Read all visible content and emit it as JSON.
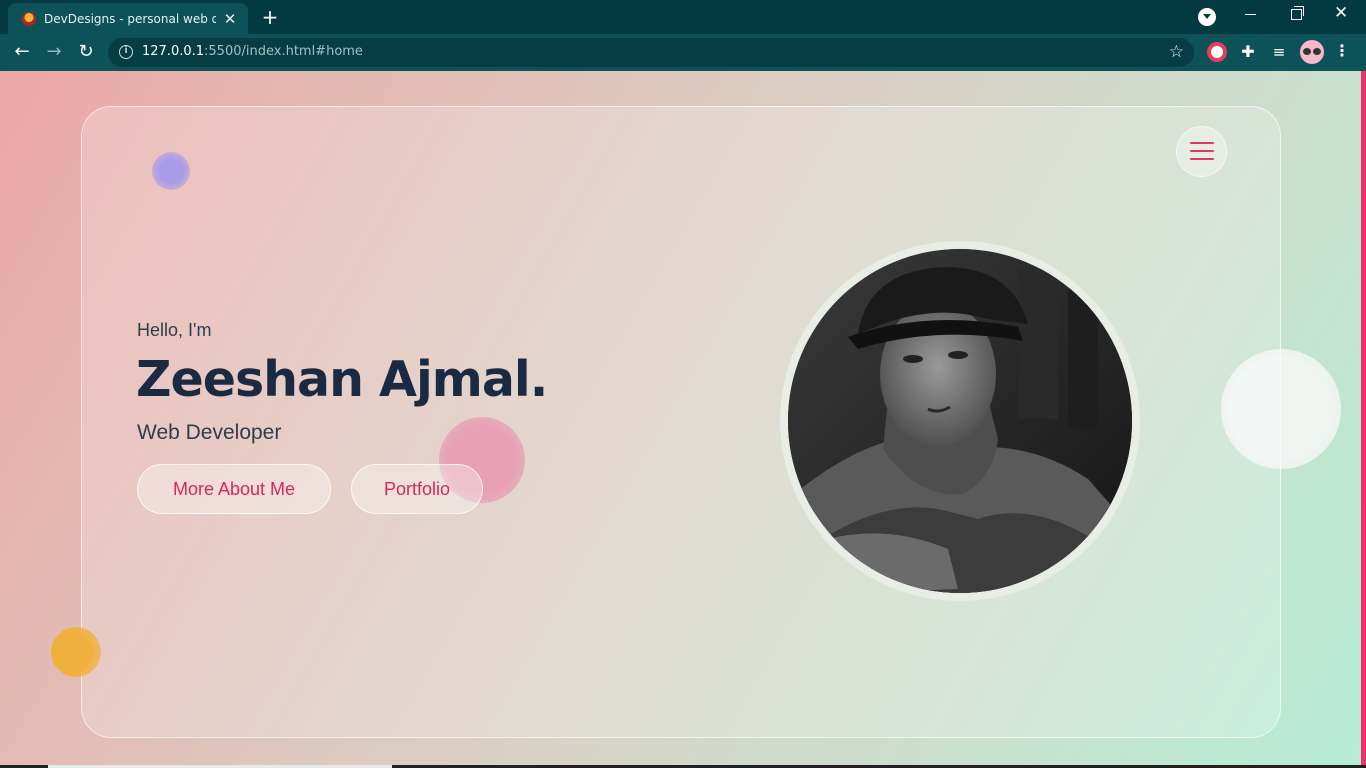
{
  "browser": {
    "tab_title": "DevDesigns - personal web developer portfolio",
    "new_tab_symbol": "+",
    "url_host": "127.0.0.1",
    "url_rest": ":5500/index.html#home"
  },
  "page": {
    "greeting": "Hello, I'm",
    "name": "Zeeshan Ajmal.",
    "role": "Web Developer",
    "buttons": {
      "about": "More About Me",
      "portfolio": "Portfolio"
    }
  },
  "colors": {
    "accent": "#e3336a",
    "name_text": "#1b2a43",
    "chrome_dark": "#033940",
    "chrome_toolbar": "#0d5159"
  },
  "icons": [
    "favicon-icon",
    "close-icon",
    "plus-icon",
    "tab-search-icon",
    "back-icon",
    "forward-icon",
    "reload-icon",
    "info-icon",
    "star-icon",
    "record-extension-icon",
    "puzzle-icon",
    "media-icon",
    "profile-avatar",
    "more-icon",
    "hamburger-menu-icon"
  ]
}
